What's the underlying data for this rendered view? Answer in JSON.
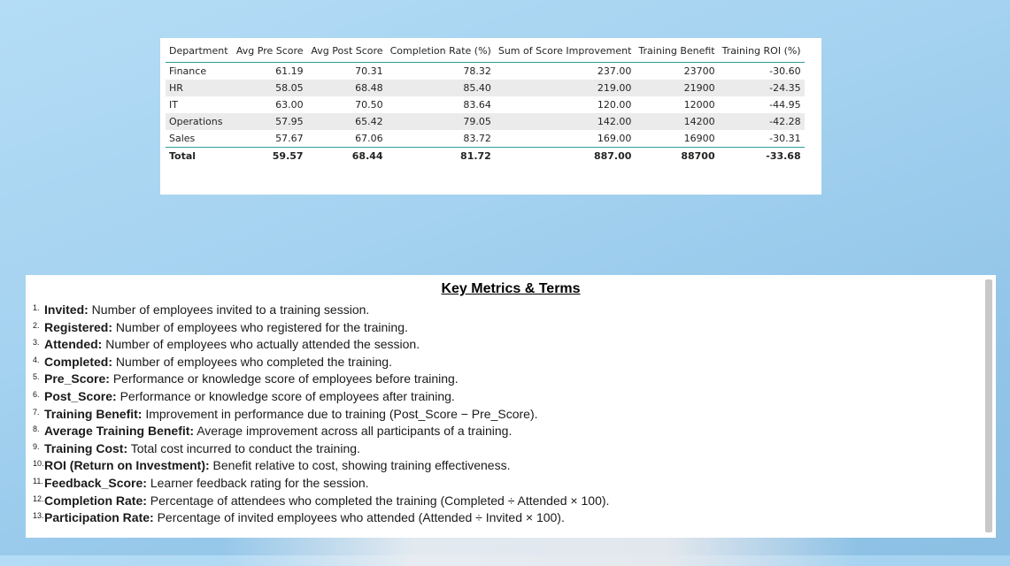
{
  "table": {
    "headers": [
      "Department",
      "Avg Pre Score",
      "Avg Post Score",
      "Completion Rate (%)",
      "Sum of Score Improvement",
      "Training Benefit",
      "Training ROI (%)"
    ],
    "rows": [
      [
        "Finance",
        "61.19",
        "70.31",
        "78.32",
        "237.00",
        "23700",
        "-30.60"
      ],
      [
        "HR",
        "58.05",
        "68.48",
        "85.40",
        "219.00",
        "21900",
        "-24.35"
      ],
      [
        "IT",
        "63.00",
        "70.50",
        "83.64",
        "120.00",
        "12000",
        "-44.95"
      ],
      [
        "Operations",
        "57.95",
        "65.42",
        "79.05",
        "142.00",
        "14200",
        "-42.28"
      ],
      [
        "Sales",
        "57.67",
        "67.06",
        "83.72",
        "169.00",
        "16900",
        "-30.31"
      ]
    ],
    "total": [
      "Total",
      "59.57",
      "68.44",
      "81.72",
      "887.00",
      "88700",
      "-33.68"
    ]
  },
  "terms": {
    "title": "Key Metrics & Terms ",
    "items": [
      {
        "n": "1.",
        "term": "Invited:",
        "desc": " Number of employees invited to a training session."
      },
      {
        "n": "2.",
        "term": "Registered:",
        "desc": " Number of employees who registered for the training."
      },
      {
        "n": "3.",
        "term": "Attended:",
        "desc": " Number of employees who actually attended the session."
      },
      {
        "n": "4.",
        "term": "Completed:",
        "desc": " Number of employees who completed the training."
      },
      {
        "n": "5.",
        "term": "Pre_Score:",
        "desc": " Performance or knowledge score of employees before training."
      },
      {
        "n": "6.",
        "term": "Post_Score:",
        "desc": " Performance or knowledge score of employees after training."
      },
      {
        "n": "7.",
        "term": "Training Benefit:",
        "desc": " Improvement in performance due to training (Post_Score − Pre_Score)."
      },
      {
        "n": "8.",
        "term": "Average Training Benefit:",
        "desc": " Average improvement across all participants of a training."
      },
      {
        "n": "9.",
        "term": "Training Cost:",
        "desc": " Total cost incurred to conduct the training."
      },
      {
        "n": "10.",
        "term": "ROI (Return on Investment):",
        "desc": " Benefit relative to cost, showing training effectiveness."
      },
      {
        "n": "11.",
        "term": "Feedback_Score:",
        "desc": " Learner feedback rating for the session."
      },
      {
        "n": "12.",
        "term": "Completion Rate:",
        "desc": " Percentage of attendees who completed the training (Completed ÷ Attended × 100)."
      },
      {
        "n": "13.",
        "term": "Participation Rate:",
        "desc": " Percentage of invited employees who attended (Attended ÷ Invited × 100)."
      }
    ]
  }
}
